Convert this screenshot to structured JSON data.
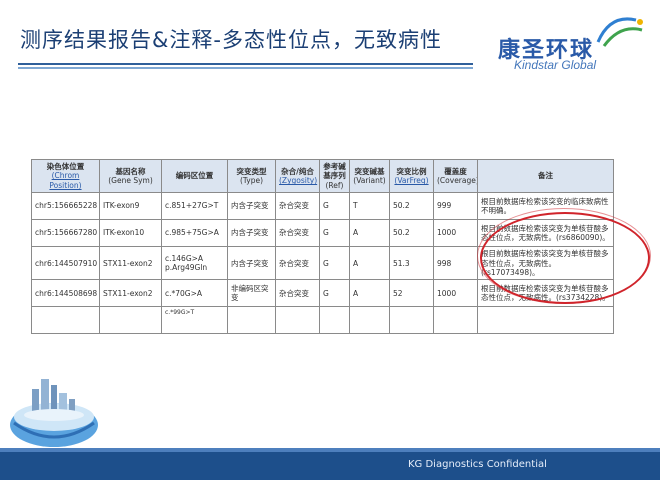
{
  "header": {
    "title": "测序结果报告&注释-多态性位点，无致病性"
  },
  "logo": {
    "cn": "康圣环球",
    "en": "Kindstar Global"
  },
  "table": {
    "headers": [
      {
        "cn": "染色体位置",
        "en": "(Chrom Position)"
      },
      {
        "cn": "基因名称",
        "en": "(Gene Sym)"
      },
      {
        "cn": "编码区位置",
        "en": ""
      },
      {
        "cn": "突变类型",
        "en": "(Type)"
      },
      {
        "cn": "杂合/纯合",
        "en": "(Zygosity)"
      },
      {
        "cn": "参考碱基序列",
        "en": "(Ref)"
      },
      {
        "cn": "突变碱基",
        "en": "(Variant)"
      },
      {
        "cn": "突变比例",
        "en": "(VarFreq)"
      },
      {
        "cn": "覆盖度",
        "en": "(Coverage)"
      },
      {
        "cn": "备注",
        "en": ""
      }
    ],
    "rows": [
      [
        "chr5:156665228",
        "ITK-exon9",
        "c.851+27G>T",
        "内含子突变",
        "杂合突变",
        "G",
        "T",
        "50.2",
        "999",
        "根目前数据库检索该突变的临床致病性不明确。"
      ],
      [
        "chr5:156667280",
        "ITK-exon10",
        "c.985+75G>A",
        "内含子突变",
        "杂合突变",
        "G",
        "A",
        "50.2",
        "1000",
        "根目前数据库检索该突变为单核苷酸多态性位点，无致病性。(rs6860090)。"
      ],
      [
        "chr6:144507910",
        "STX11-exon2",
        "c.146G>A p.Arg49Gln",
        "内含子突变",
        "杂合突变",
        "G",
        "A",
        "51.3",
        "998",
        "根目前数据库检索该突变为单核苷酸多态性位点，无致病性。(rs17073498)。"
      ],
      [
        "chr6:144508698",
        "STX11-exon2",
        "c.*70G>A",
        "非编码区突变",
        "杂合突变",
        "G",
        "A",
        "52",
        "1000",
        "根目前数据库检索该突变为单核苷酸多态性位点，无致病性。(rs3734228)。"
      ]
    ],
    "truncated_cell": "c.*99G>T"
  },
  "footer": {
    "text": "KG Diagnostics Confidential"
  },
  "colors": {
    "title": "#1b3f74",
    "header_bg": "#dbe4f0",
    "highlight_circle": "#d0242b",
    "footer_band": "#1d4f8b"
  }
}
